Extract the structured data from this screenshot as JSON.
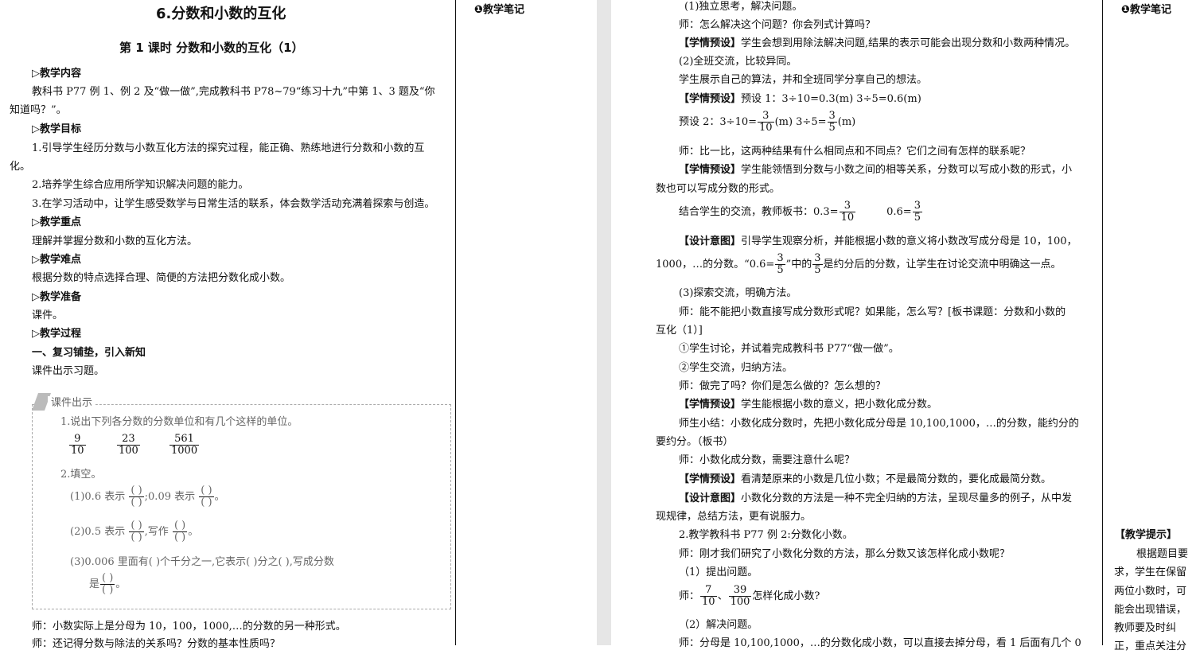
{
  "left_page": {
    "chapter_title": "6.分数和小数的互化",
    "lesson_title": "第 1 课时  分数和小数的互化（1）",
    "sections": {
      "content_heading": "▷教学内容",
      "content_text_1": "教科书 P77 例 1、例 2 及“做一做”,完成教科书 P78~79“练习十九”中第 1、3 题及“你",
      "content_text_2": "知道吗？”。",
      "goals_heading": "▷教学目标",
      "goal_1a": "1.引导学生经历分数与小数互化方法的探究过程，能正确、熟练地进行分数和小数的互",
      "goal_1b": "化。",
      "goal_2": "2.培养学生综合应用所学知识解决问题的能力。",
      "goal_3": "3.在学习活动中，让学生感受数学与日常生活的联系，体会数学活动充满着探索与创造。",
      "key_heading": "▷教学重点",
      "key_text": "理解并掌握分数和小数的互化方法。",
      "difficult_heading": "▷教学难点",
      "difficult_text": "根据分数的特点选择合理、简便的方法把分数化成小数。",
      "prep_heading": "▷教学准备",
      "prep_text": "课件。",
      "process_heading": "▷教学过程",
      "step_1_heading": "一、复习铺垫，引入新知",
      "step_1_text": "课件出示习题。"
    },
    "courseware": {
      "label": "课件出示",
      "q1": "1.说出下列各分数的分数单位和有几个这样的单位。",
      "fractions": [
        {
          "num": "9",
          "den": "10"
        },
        {
          "num": "23",
          "den": "100"
        },
        {
          "num": "561",
          "den": "1000"
        }
      ],
      "q2": "2.填空。",
      "q2_1_a": "(1)0.6 表示",
      "q2_1_b": ";0.09 表示",
      "q2_1_c": "。",
      "q2_2_a": "(2)0.5 表示",
      "q2_2_b": ",写作",
      "q2_2_c": "。",
      "q2_3_a": "(3)0.006 里面有(    )个千分之一,它表示(    )分之(    ),写成分数",
      "q2_3_b": "是",
      "q2_3_c": "。",
      "paren_open": "(    )"
    },
    "footer_1": "师：小数实际上是分母为 10，100，1000,…的分数的另一种形式。",
    "footer_2": "师：还记得分数与除法的关系吗？分数的基本性质吗？"
  },
  "left_sidebar_note": "❶教学笔记",
  "right_page": {
    "lines": {
      "l1": "(1)独立思考，解决问题。",
      "l2": "师：怎么解决这个问题？你会列式计算吗？",
      "l3_tag": "【学情预设】",
      "l3": "学生会想到用除法解决问题,结果的表示可能会出现分数和小数两种情况。",
      "l4": "(2)全班交流，比较异同。",
      "l5": "学生展示自己的算法，并和全班同学分享自己的想法。",
      "l6_tag": "【学情预设】",
      "l6": "预设 1：3÷10=0.3(m)        3÷5=0.6(m)",
      "l7_a": "预设 2：3÷10=",
      "l7_b": "(m)        3÷5=",
      "l7_c": "(m)",
      "l8": "师：比一比，这两种结果有什么相同点和不同点？它们之间有怎样的联系呢？",
      "l9_tag": "【学情预设】",
      "l9": "学生能领悟到分数与小数之间的相等关系，分数可以写成小数的形式，小",
      "l10": "数也可以写成分数的形式。",
      "l11_a": "结合学生的交流，教师板书：0.3=",
      "l11_b": "0.6=",
      "l12_tag": "【设计意图】",
      "l12": "引导学生观察分析，并能根据小数的意义将小数改写成分母是 10，100，",
      "l13_a": "1000，…的分数。“0.6=",
      "l13_b": "”中的",
      "l13_c": "是约分后的分数，让学生在讨论交流中明确这一点。",
      "l14": "(3)探索交流，明确方法。",
      "l15": "师：能不能把小数直接写成分数形式呢？如果能，怎么写？[板书课题：分数和小数的",
      "l16": "互化（1）]",
      "l17": "①学生讨论，并试着完成教科书 P77“做一做”。",
      "l18": "②学生交流，归纳方法。",
      "l19": "师：做完了吗？你们是怎么做的？怎么想的？",
      "l20_tag": "【学情预设】",
      "l20": "学生能根据小数的意义，把小数化成分数。",
      "l21": "师生小结：小数化成分数时，先把小数化成分母是 10,100,1000，…的分数，能约分的",
      "l22": "要约分。（板书）",
      "l23": "师：小数化成分数，需要注意什么呢？",
      "l24_tag": "【学情预设】",
      "l24": "看清楚原来的小数是几位小数；不是最简分数的，要化成最简分数。",
      "l25_tag": "【设计意图】",
      "l25": "小数化分数的方法是一种不完全归纳的方法，呈现尽量多的例子，从中发",
      "l26": "现规律，总结方法，更有说服力。",
      "l27": "2.教学教科书 P77 例 2:分数化小数。",
      "l28": "师：刚才我们研究了小数化分数的方法，那么分数又该怎样化成小数呢？",
      "l29": "（1）提出问题。",
      "l30_a": "师：",
      "l30_b": "、",
      "l30_c": "怎样化成小数?",
      "l31": "（2）解决问题。",
      "l32": "师：分母是 10,100,1000，…的分数化成小数，可以直接去掉分母，看 1 后面有几个 0"
    },
    "fractions": {
      "three_tenths": {
        "num": "3",
        "den": "10"
      },
      "three_fifths": {
        "num": "3",
        "den": "5"
      },
      "seven_tenths": {
        "num": "7",
        "den": "10"
      },
      "thirtynine_hundredths": {
        "num": "39",
        "den": "100"
      }
    }
  },
  "right_sidebar": {
    "note": "❶教学笔记",
    "tip_heading": "【教学提示】",
    "tip_lines": [
      "根据题目要",
      "求，学生在保留",
      "两位小数时，可",
      "能会出现错误，",
      "教师要及时纠",
      "正，重点关注分"
    ]
  }
}
